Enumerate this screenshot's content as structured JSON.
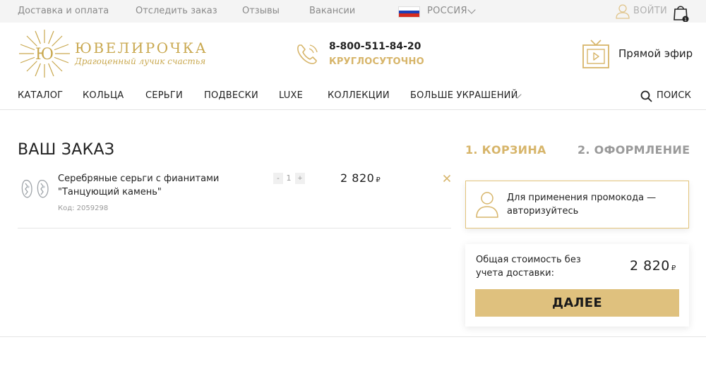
{
  "topbar": {
    "links": [
      "Доставка и оплата",
      "Отследить заказ",
      "Отзывы",
      "Вакансии"
    ],
    "country": "РОССИЯ",
    "login": "ВОЙТИ",
    "cart_count": "1"
  },
  "header": {
    "brand_name": "ЮВЕЛИРОЧКА",
    "brand_initial": "Ю",
    "tagline": "Драгоценный лучик счастья",
    "phone": "8-800-511-84-20",
    "phone_note": "КРУГЛОСУТОЧНО",
    "live": "Прямой эфир"
  },
  "nav": {
    "items": [
      "КАТАЛОГ",
      "КОЛЬЦА",
      "СЕРЬГИ",
      "ПОДВЕСКИ",
      "LUXE",
      "КОЛЛЕКЦИИ",
      "БОЛЬШЕ УКРАШЕНИЙ"
    ],
    "search": "ПОИСК"
  },
  "order": {
    "title": "ВАШ ЗАКАЗ",
    "item": {
      "name": "Серебряные серьги с фианитами \"Танцующий камень\"",
      "code": "Код: 2059298",
      "qty": "1",
      "minus": "-",
      "plus": "+",
      "price": "2 820",
      "currency": "₽"
    }
  },
  "steps": [
    "1. КОРЗИНА",
    "2. ОФОРМЛЕНИЕ"
  ],
  "promo": {
    "text": "Для применения промокода — авторизуйтесь"
  },
  "summary": {
    "label": "Общая стоимость без учета доставки:",
    "value": "2 820",
    "currency": "₽",
    "button": "ДАЛЕЕ"
  },
  "colors": {
    "gold": "#c9a84f",
    "gold_light": "#d7b56a",
    "button": "#dfc17e",
    "flag": [
      "#ffffff",
      "#1c3fb8",
      "#d52b1e"
    ]
  }
}
